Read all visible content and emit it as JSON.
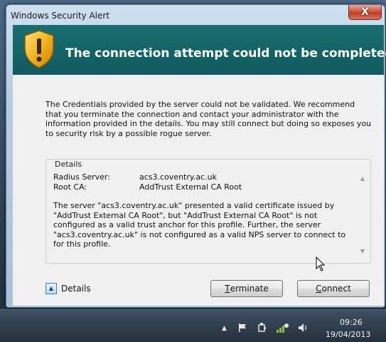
{
  "window": {
    "title": "Windows Security Alert",
    "close_label": "X"
  },
  "banner": {
    "title": "The connection attempt could not be completed"
  },
  "message": "The Credentials provided by the server could not be validated. We recommend that you terminate the connection and contact your administrator with the information provided in the details. You may still connect but doing so exposes you to security risk by a possible rogue server.",
  "details": {
    "legend": "Details",
    "rows": [
      {
        "key": "Radius Server:",
        "value": "acs3.coventry.ac.uk"
      },
      {
        "key": "Root CA:",
        "value": "AddTrust External CA Root"
      }
    ],
    "body": "The server \"acs3.coventry.ac.uk\" presented a valid certificate issued by \"AddTrust External CA Root\", but \"AddTrust External CA Root\" is not configured as a valid trust anchor for this profile. Further, the server \"acs3.coventry.ac.uk\" is not configured as a valid NPS server to connect to for this profile."
  },
  "controls": {
    "details_toggle_label": "Details",
    "terminate_prefix": "T",
    "terminate_rest": "erminate",
    "connect_prefix": "C",
    "connect_rest": "onnect"
  },
  "taskbar": {
    "time": "09:26",
    "date": "19/04/2013",
    "icons": [
      "show-hidden-icons",
      "action-center-flag-icon",
      "power-icon",
      "network-icon",
      "volume-icon"
    ]
  },
  "colors": {
    "banner": "#14676a",
    "close_button": "#c9472f"
  }
}
